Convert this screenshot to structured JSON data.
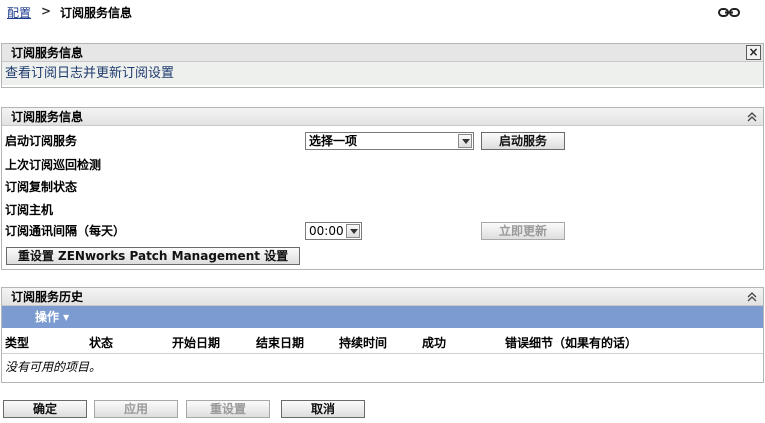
{
  "breadcrumb": {
    "root": "配置",
    "separator": ">",
    "current": "订阅服务信息"
  },
  "info_panel": {
    "title": "订阅服务信息",
    "close_label": "×",
    "description": "查看订阅日志并更新订阅设置"
  },
  "service_panel": {
    "title": "订阅服务信息",
    "rows": {
      "start": "启动订阅服务",
      "last_poll": "上次订阅巡回检测",
      "replication": "订阅复制状态",
      "host": "订阅主机",
      "interval": "订阅通讯间隔（每天）"
    },
    "start_select_value": "选择一项",
    "start_button": "启动服务",
    "interval_select_value": "00:00",
    "update_button": "立即更新",
    "reset_button": "重设置 ZENworks Patch Management 设置"
  },
  "history_panel": {
    "title": "订阅服务历史",
    "action_menu": "操作 ▾",
    "columns": [
      "类型",
      "状态",
      "开始日期",
      "结束日期",
      "持续时间",
      "成功",
      "错误细节（如果有的话）"
    ],
    "empty_text": "没有可用的项目。"
  },
  "footer": {
    "ok": "确定",
    "apply": "应用",
    "reset": "重设置",
    "cancel": "取消"
  }
}
